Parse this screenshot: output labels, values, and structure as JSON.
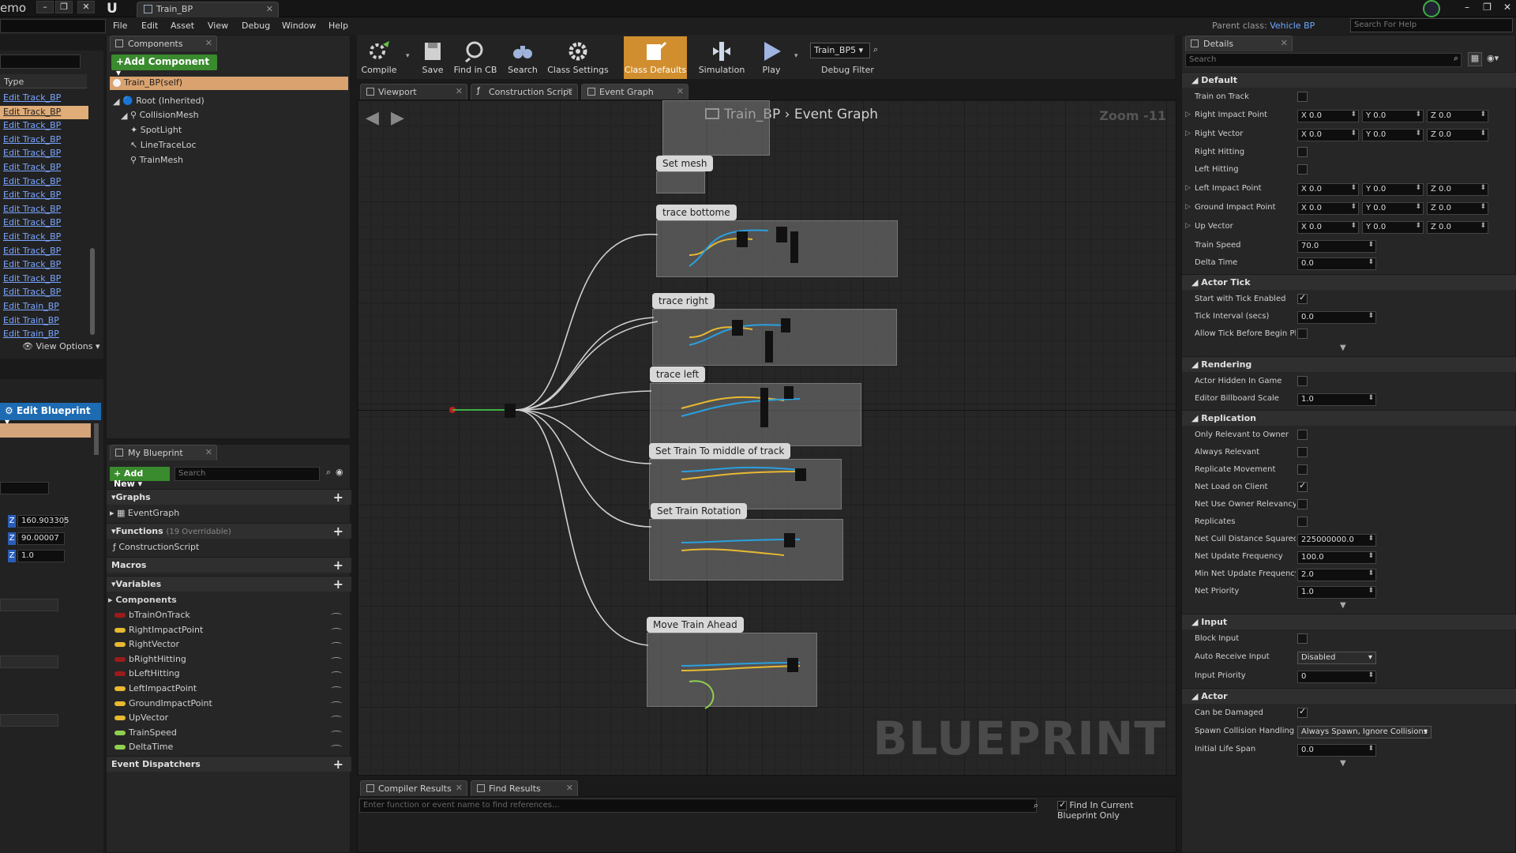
{
  "titlebar": {
    "app_fragment": "emo",
    "doc_tab": "Train_BP"
  },
  "menu": [
    "File",
    "Edit",
    "Asset",
    "View",
    "Debug",
    "Window",
    "Help"
  ],
  "parent_class": {
    "label": "Parent class:",
    "value": "Vehicle BP"
  },
  "help_search_placeholder": "Search For Help",
  "left_list": {
    "type_header": "Type",
    "items": [
      "Edit Track_BP",
      "Edit Track_BP",
      "Edit Track_BP",
      "Edit Track_BP",
      "Edit Track_BP",
      "Edit Track_BP",
      "Edit Track_BP",
      "Edit Track_BP",
      "Edit Track_BP",
      "Edit Track_BP",
      "Edit Track_BP",
      "Edit Track_BP",
      "Edit Track_BP",
      "Edit Track_BP",
      "Edit Track_BP",
      "Edit Train_BP",
      "Edit Train_BP",
      "Edit Train_BP"
    ],
    "selected_index": 1,
    "view_options": "View Options"
  },
  "left_lower": {
    "edit_blueprint": "Edit Blueprint",
    "z_values": [
      "160.903305",
      "90.00007",
      "1.0"
    ]
  },
  "components": {
    "tab": "Components",
    "add_button": "+Add Component",
    "self_row": "Train_BP(self)",
    "tree": [
      "Root (Inherited)",
      "CollisionMesh",
      "SpotLight",
      "LineTraceLoc",
      "TrainMesh"
    ]
  },
  "my_blueprint": {
    "tab": "My Blueprint",
    "add_new": "+ Add New",
    "search_placeholder": "Search",
    "graphs_label": "Graphs",
    "graphs": [
      "EventGraph"
    ],
    "functions_label": "Functions",
    "functions_sub": "(19 Overridable)",
    "functions": [
      "ConstructionScript"
    ],
    "macros_label": "Macros",
    "variables_label": "Variables",
    "components_label": "Components",
    "variables": [
      {
        "name": "bTrainOnTrack",
        "color": "#9b1b1b"
      },
      {
        "name": "RightImpactPoint",
        "color": "#e8b931"
      },
      {
        "name": "RightVector",
        "color": "#e8b931"
      },
      {
        "name": "bRightHitting",
        "color": "#9b1b1b"
      },
      {
        "name": "bLeftHitting",
        "color": "#9b1b1b"
      },
      {
        "name": "LeftImpactPoint",
        "color": "#e8b931"
      },
      {
        "name": "GroundImpactPoint",
        "color": "#e8b931"
      },
      {
        "name": "UpVector",
        "color": "#e8b931"
      },
      {
        "name": "TrainSpeed",
        "color": "#8fd14f"
      },
      {
        "name": "DeltaTime",
        "color": "#8fd14f"
      }
    ],
    "dispatchers_label": "Event Dispatchers"
  },
  "toolbar": {
    "buttons": [
      "Compile",
      "Save",
      "Find in CB",
      "Search",
      "Class Settings",
      "Class Defaults",
      "Simulation",
      "Play"
    ],
    "active": "Class Defaults",
    "debug_object": "Train_BP5",
    "debug_filter": "Debug Filter"
  },
  "graph_tabs": [
    "Viewport",
    "Construction Script",
    "Event Graph"
  ],
  "graph": {
    "breadcrumb_root": "Train_BP",
    "breadcrumb_leaf": "Event Graph",
    "zoom": "Zoom -11",
    "watermark": "BLUEPRINT",
    "comments": [
      "Set mesh",
      "trace bottome",
      "trace right",
      "trace left",
      "Set Train To middle of track",
      "Set Train Rotation",
      "Move Train Ahead"
    ]
  },
  "bottom": {
    "tabs": [
      "Compiler Results",
      "Find Results"
    ],
    "find_placeholder": "Enter function or event name to find references...",
    "find_current_only": "Find In Current Blueprint Only"
  },
  "details": {
    "tab": "Details",
    "search_placeholder": "Search",
    "categories": {
      "default": "Default",
      "actor_tick": "Actor Tick",
      "rendering": "Rendering",
      "replication": "Replication",
      "input": "Input",
      "actor": "Actor"
    },
    "default_props": {
      "train_on_track": "Train on Track",
      "right_impact_point": "Right Impact Point",
      "right_vector": "Right Vector",
      "right_hitting": "Right Hitting",
      "left_hitting": "Left Hitting",
      "left_impact_point": "Left Impact Point",
      "ground_impact_point": "Ground Impact Point",
      "up_vector": "Up Vector",
      "train_speed": "Train Speed",
      "train_speed_val": "70.0",
      "delta_time": "Delta Time",
      "delta_time_val": "0.0",
      "vec_x": "X 0.0",
      "vec_y": "Y 0.0",
      "vec_z": "Z 0.0"
    },
    "tick_props": {
      "start_tick": "Start with Tick Enabled",
      "tick_interval": "Tick Interval (secs)",
      "tick_interval_val": "0.0",
      "allow_tick": "Allow Tick Before Begin Pl"
    },
    "rendering_props": {
      "hidden": "Actor Hidden In Game",
      "billboard": "Editor Billboard Scale",
      "billboard_val": "1.0"
    },
    "replication_props": {
      "only_relevant": "Only Relevant to Owner",
      "always_relevant": "Always Relevant",
      "replicate_movement": "Replicate Movement",
      "net_load": "Net Load on Client",
      "net_use_owner": "Net Use Owner Relevancy",
      "replicates": "Replicates",
      "cull": "Net Cull Distance Squared",
      "cull_val": "225000000.0",
      "update_freq": "Net Update Frequency",
      "update_freq_val": "100.0",
      "min_update": "Min Net Update Frequency",
      "min_update_val": "2.0",
      "priority": "Net Priority",
      "priority_val": "1.0"
    },
    "input_props": {
      "block": "Block Input",
      "auto_receive": "Auto Receive Input",
      "auto_receive_val": "Disabled",
      "priority": "Input Priority",
      "priority_val": "0"
    },
    "actor_props": {
      "can_damage": "Can be Damaged",
      "spawn": "Spawn Collision Handling M",
      "spawn_val": "Always Spawn, Ignore Collisions",
      "life": "Initial Life Span",
      "life_val": "0.0"
    }
  }
}
